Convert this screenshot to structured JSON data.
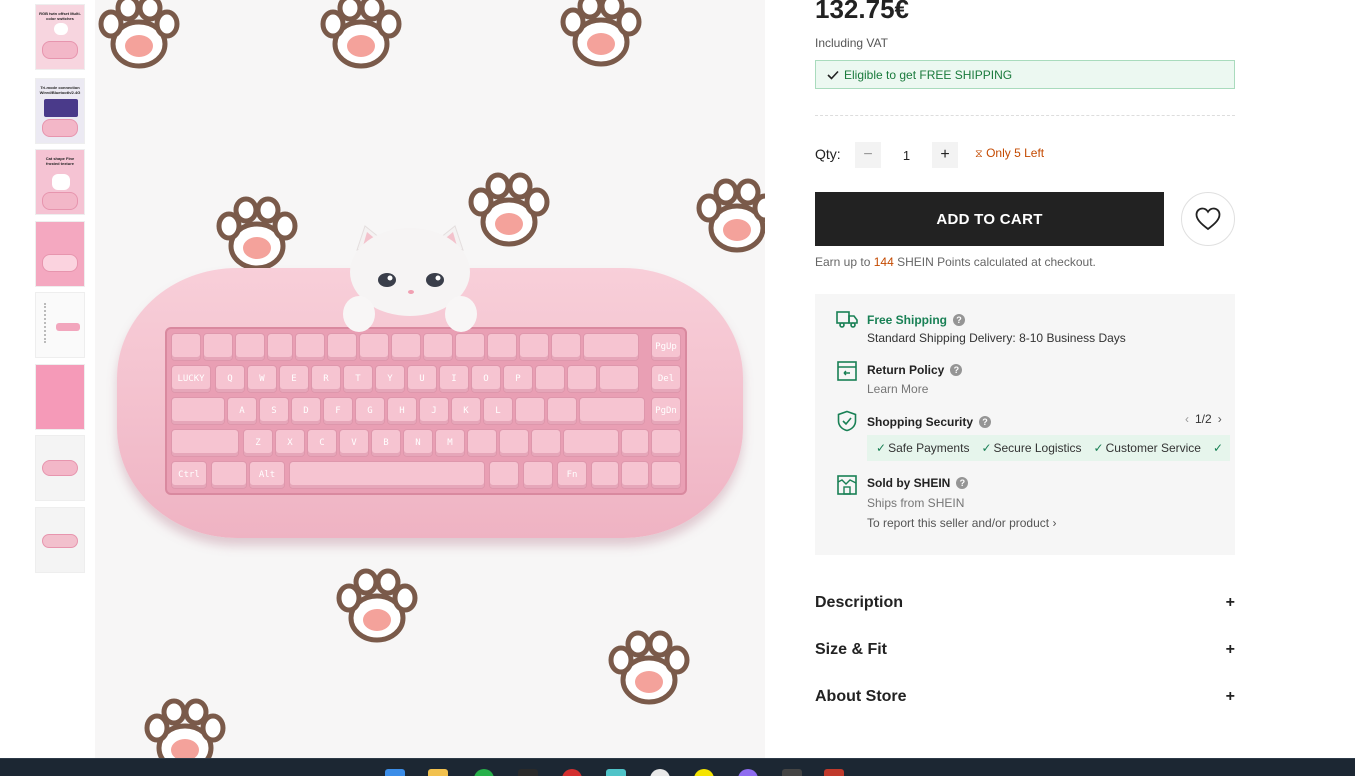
{
  "product": {
    "price": "132.75€",
    "vat_note": "Including VAT",
    "free_shipping_banner": "Eligible to get FREE SHIPPING"
  },
  "quantity": {
    "label": "Qty:",
    "value": "1",
    "minus": "−",
    "plus": "+",
    "stock_note": "Only 5 Left"
  },
  "actions": {
    "add_to_cart": "ADD TO CART",
    "points_prefix": "Earn up to",
    "points_value": "144",
    "points_suffix": "SHEIN Points calculated at checkout."
  },
  "info": {
    "free_shipping": {
      "title": "Free Shipping",
      "detail": "Standard Shipping Delivery: 8-10 Business Days"
    },
    "return_policy": {
      "title": "Return Policy",
      "link": "Learn More"
    },
    "shopping_security": {
      "title": "Shopping Security",
      "pager": "1/2",
      "items": [
        "Safe Payments",
        "Secure Logistics",
        "Customer Service"
      ]
    },
    "seller": {
      "title": "Sold by SHEIN",
      "ships_from": "Ships from SHEIN",
      "report": "To report this seller and/or product"
    }
  },
  "accordion": [
    {
      "label": "Description"
    },
    {
      "label": "Size & Fit"
    },
    {
      "label": "About Store"
    }
  ],
  "keyboard_legends": [
    "LUCKY",
    "Q",
    "W",
    "E",
    "R",
    "T",
    "Y",
    "U",
    "I",
    "O",
    "P",
    "A",
    "S",
    "D",
    "F",
    "G",
    "H",
    "J",
    "K",
    "L",
    "Z",
    "X",
    "C",
    "V",
    "B",
    "N",
    "M",
    "Ctrl",
    "Alt",
    "Fn",
    "Del",
    "PgUp",
    "PgDn"
  ],
  "thumbnails": [
    {
      "caption": "RGB twin offset Multi-color switches"
    },
    {
      "caption": "Tri-mode connection Wired/Bluetooth/2.4G"
    },
    {
      "caption": "Cat shape Fine frosted texture"
    },
    {
      "caption": ""
    },
    {
      "caption": ""
    },
    {
      "caption": ""
    },
    {
      "caption": ""
    },
    {
      "caption": ""
    }
  ],
  "colors": {
    "accent_orange": "#c44a01",
    "green": "#198055",
    "dark": "#222222"
  }
}
